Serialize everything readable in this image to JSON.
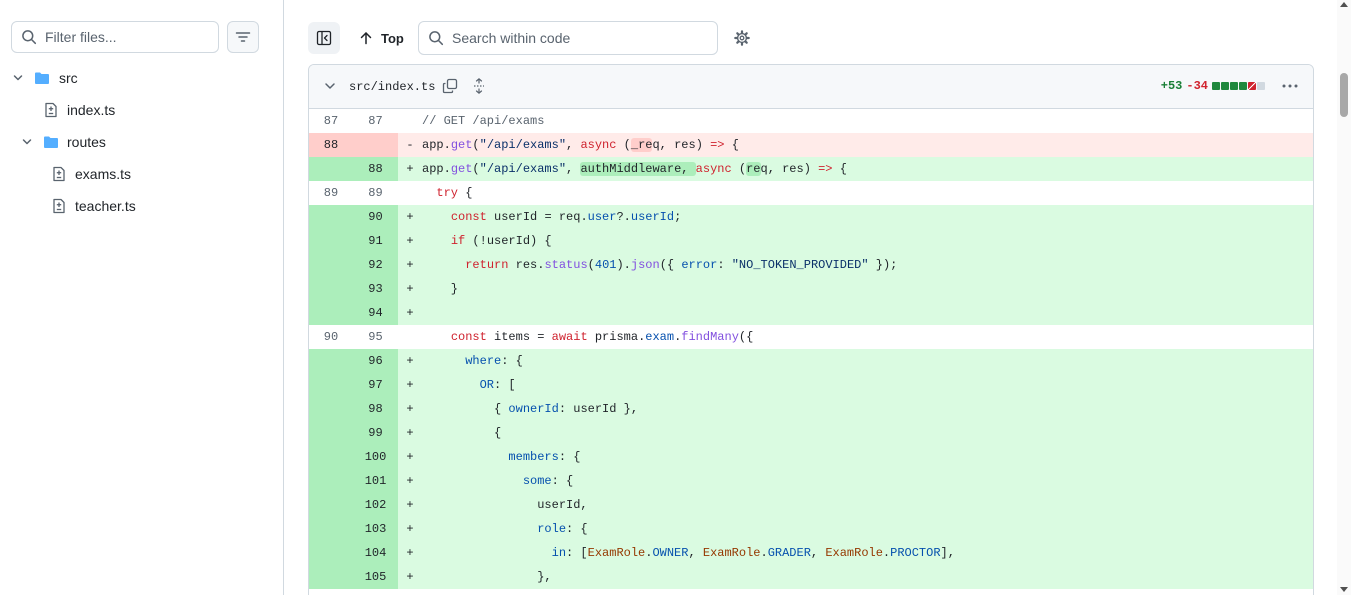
{
  "colors": {
    "addition_bg": "#dafbe1",
    "addition_gutter": "#aceebb",
    "deletion_bg": "#ffebe9",
    "deletion_gutter": "#ffcecb",
    "folder": "#54aeff",
    "added_count": "#1a7f37",
    "deleted_count": "#d1242f"
  },
  "sidebar": {
    "filter_placeholder": "Filter files...",
    "tree": [
      {
        "type": "folder",
        "name": "src"
      },
      {
        "type": "file",
        "name": "index.ts"
      },
      {
        "type": "folder",
        "name": "routes"
      },
      {
        "type": "file",
        "name": "exams.ts"
      },
      {
        "type": "file",
        "name": "teacher.ts"
      }
    ]
  },
  "toolbar": {
    "top_label": "Top",
    "search_placeholder": "Search within code"
  },
  "file": {
    "path": "src/index.ts",
    "additions": "+53",
    "deletions": "-34",
    "diffstat": [
      "add",
      "add",
      "add",
      "add",
      "del"
    ]
  },
  "diff": [
    {
      "kind": "ctx",
      "old": "87",
      "new": "87",
      "marker": "",
      "code": "// GET /api/exams"
    },
    {
      "kind": "del",
      "old": "88",
      "new": "",
      "marker": "-",
      "code": "app.get(\"/api/exams\", async (_req, res) => {"
    },
    {
      "kind": "add",
      "old": "",
      "new": "88",
      "marker": "+",
      "code": "app.get(\"/api/exams\", authMiddleware, async (req, res) => {"
    },
    {
      "kind": "ctx",
      "old": "89",
      "new": "89",
      "marker": "",
      "code": "  try {"
    },
    {
      "kind": "add",
      "old": "",
      "new": "90",
      "marker": "+",
      "code": "    const userId = req.user?.userId;"
    },
    {
      "kind": "add",
      "old": "",
      "new": "91",
      "marker": "+",
      "code": "    if (!userId) {"
    },
    {
      "kind": "add",
      "old": "",
      "new": "92",
      "marker": "+",
      "code": "      return res.status(401).json({ error: \"NO_TOKEN_PROVIDED\" });"
    },
    {
      "kind": "add",
      "old": "",
      "new": "93",
      "marker": "+",
      "code": "    }"
    },
    {
      "kind": "add",
      "old": "",
      "new": "94",
      "marker": "+",
      "code": ""
    },
    {
      "kind": "ctx",
      "old": "90",
      "new": "95",
      "marker": "",
      "code": "    const items = await prisma.exam.findMany({"
    },
    {
      "kind": "add",
      "old": "",
      "new": "96",
      "marker": "+",
      "code": "      where: {"
    },
    {
      "kind": "add",
      "old": "",
      "new": "97",
      "marker": "+",
      "code": "        OR: ["
    },
    {
      "kind": "add",
      "old": "",
      "new": "98",
      "marker": "+",
      "code": "          { ownerId: userId },"
    },
    {
      "kind": "add",
      "old": "",
      "new": "99",
      "marker": "+",
      "code": "          {"
    },
    {
      "kind": "add",
      "old": "",
      "new": "100",
      "marker": "+",
      "code": "            members: {"
    },
    {
      "kind": "add",
      "old": "",
      "new": "101",
      "marker": "+",
      "code": "              some: {"
    },
    {
      "kind": "add",
      "old": "",
      "new": "102",
      "marker": "+",
      "code": "                userId,"
    },
    {
      "kind": "add",
      "old": "",
      "new": "103",
      "marker": "+",
      "code": "                role: {"
    },
    {
      "kind": "add",
      "old": "",
      "new": "104",
      "marker": "+",
      "code": "                  in: [ExamRole.OWNER, ExamRole.GRADER, ExamRole.PROCTOR],"
    },
    {
      "kind": "add",
      "old": "",
      "new": "105",
      "marker": "+",
      "code": "                },"
    }
  ]
}
